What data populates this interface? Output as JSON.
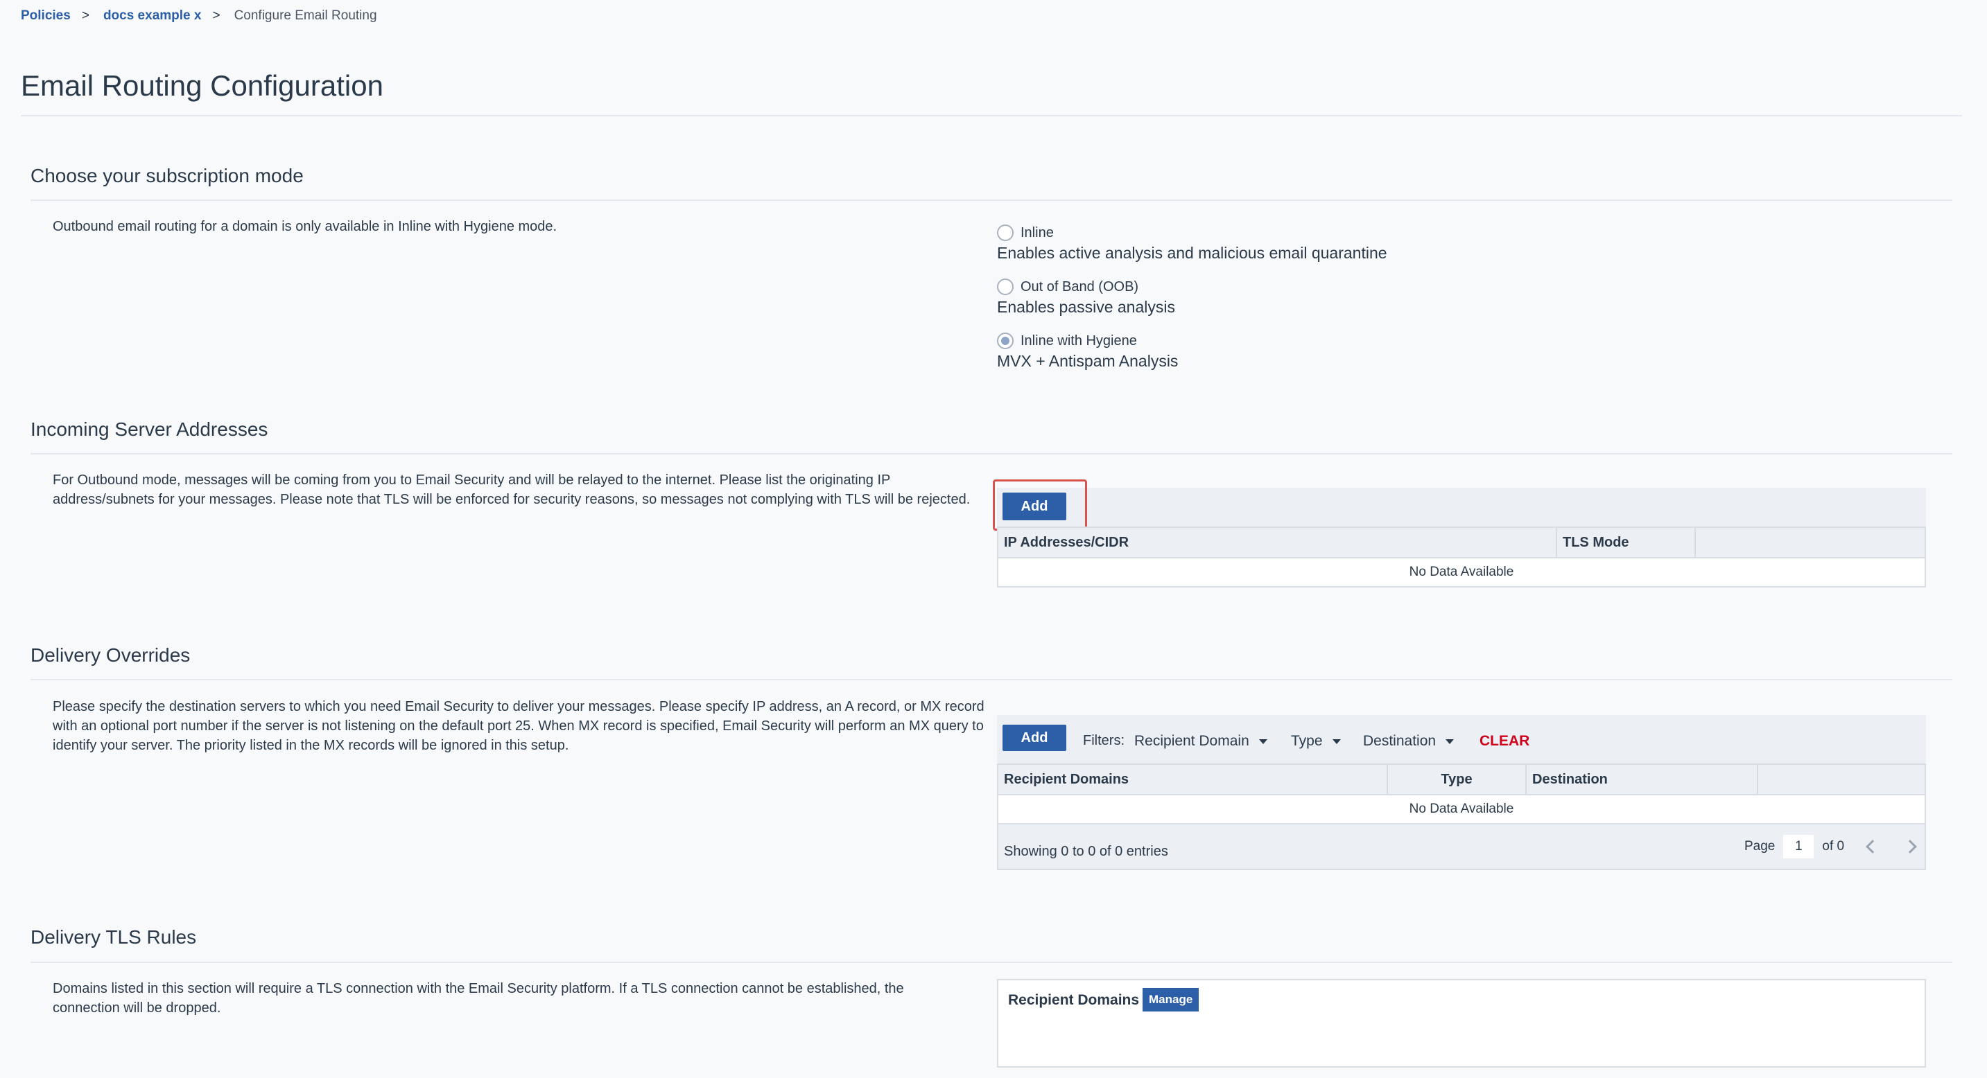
{
  "breadcrumb": {
    "items": [
      "Policies",
      "docs example x"
    ],
    "separator": ">",
    "current": "Configure Email Routing"
  },
  "page_title": "Email Routing Configuration",
  "subscription": {
    "title": "Choose your subscription mode",
    "description": "Outbound email routing for a domain is only available in Inline with Hygiene mode.",
    "options": [
      {
        "label": "Inline",
        "sub": "Enables active analysis and malicious email quarantine",
        "checked": false
      },
      {
        "label": "Out of Band (OOB)",
        "sub": "Enables passive analysis",
        "checked": false
      },
      {
        "label": "Inline with Hygiene",
        "sub": "MVX + Antispam Analysis",
        "checked": true
      }
    ]
  },
  "incoming": {
    "title": "Incoming Server Addresses",
    "description": "For Outbound mode, messages will be coming from you to Email Security and will be relayed to the internet. Please list the originating IP address/subnets for your messages. Please note that TLS will be enforced for security reasons, so messages not complying with TLS will be rejected.",
    "add_label": "Add",
    "columns": [
      "IP Addresses/CIDR",
      "TLS Mode",
      ""
    ],
    "empty_text": "No Data Available"
  },
  "overrides": {
    "title": "Delivery Overrides",
    "description": "Please specify the destination servers to which you need Email Security to deliver your messages. Please specify IP address, an A record, or MX record with an optional port number if the server is not listening on the default port 25. When MX record is specified, Email Security will perform an MX query to identify your server. The priority listed in the MX records will be ignored in this setup.",
    "add_label": "Add",
    "filters_label": "Filters:",
    "filters": [
      "Recipient Domain",
      "Type",
      "Destination"
    ],
    "clear_label": "CLEAR",
    "columns": [
      "Recipient Domains",
      "Type",
      "Destination",
      ""
    ],
    "empty_text": "No Data Available",
    "entries_text": "Showing 0 to 0 of 0 entries",
    "page_label": "Page",
    "page_value": "1",
    "page_of": "of 0"
  },
  "tls_rules": {
    "title": "Delivery TLS Rules",
    "description": "Domains listed in this section will require a TLS connection with the Email Security platform. If a TLS connection cannot be established, the connection will be dropped.",
    "recipient_label": "Recipient Domains",
    "manage_label": "Manage"
  },
  "colors": {
    "primary": "#2c5fa8",
    "clear": "#d0021b",
    "highlight": "#d9534f"
  }
}
